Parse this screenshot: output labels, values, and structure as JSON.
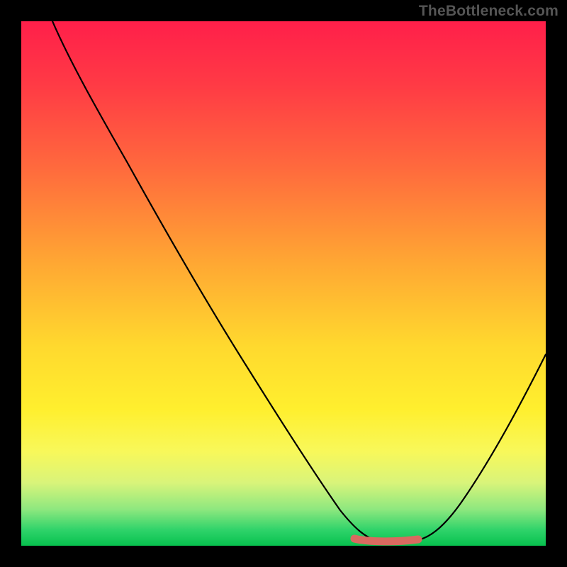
{
  "watermark": "TheBottleneck.com",
  "chart_data": {
    "type": "line",
    "title": "",
    "xlabel": "",
    "ylabel": "",
    "xlim": [
      0,
      100
    ],
    "ylim": [
      0,
      100
    ],
    "series": [
      {
        "name": "bottleneck-curve",
        "x": [
          6,
          12,
          20,
          30,
          40,
          50,
          56,
          60,
          64,
          68,
          72,
          76,
          80,
          86,
          92,
          100
        ],
        "y": [
          100,
          90,
          77,
          60,
          44,
          27,
          17,
          10,
          4,
          1,
          1,
          1,
          4,
          12,
          22,
          40
        ]
      }
    ],
    "highlight": {
      "name": "optimal-range",
      "x_start": 62,
      "x_end": 78,
      "y": 1
    },
    "background_gradient": {
      "top": "#ff1f4a",
      "mid": "#ffd92e",
      "bottom": "#07c14e"
    }
  }
}
